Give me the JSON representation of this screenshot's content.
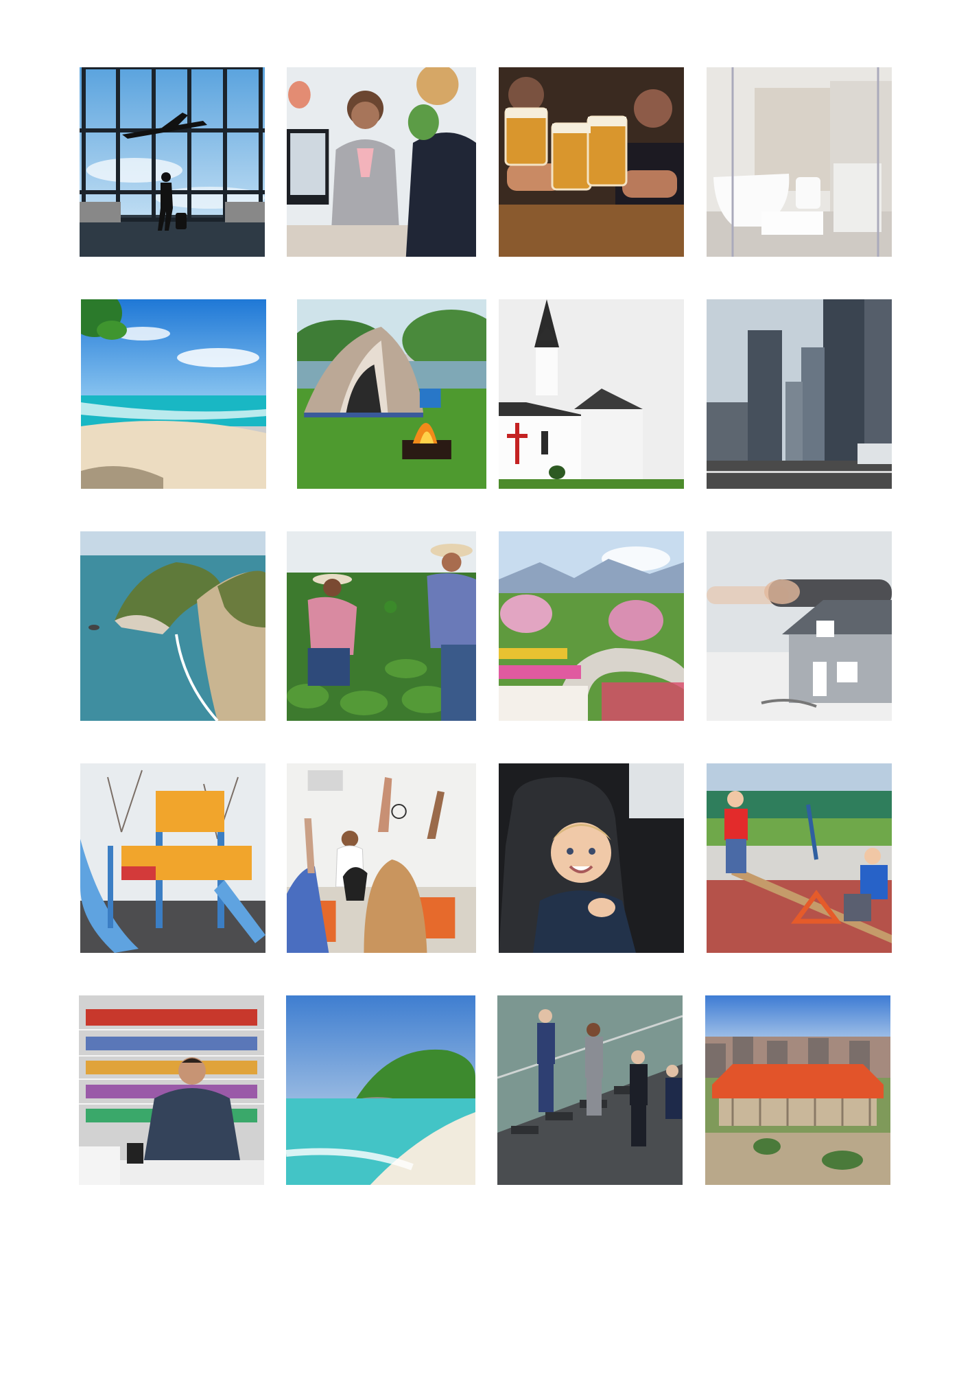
{
  "grid": {
    "rows": 5,
    "columns": 4,
    "tiles": [
      {
        "subject": "airport-traveler"
      },
      {
        "subject": "hotel-front-desk"
      },
      {
        "subject": "beer-toast"
      },
      {
        "subject": "bathroom"
      },
      {
        "subject": "tropical-beach"
      },
      {
        "subject": "tent-campfire"
      },
      {
        "subject": "white-church"
      },
      {
        "subject": "city-skyline"
      },
      {
        "subject": "coastal-cliff-cove"
      },
      {
        "subject": "farmers-in-field"
      },
      {
        "subject": "flower-garden-mountains"
      },
      {
        "subject": "house-model-handshake"
      },
      {
        "subject": "playground"
      },
      {
        "subject": "classroom-raised-hands"
      },
      {
        "subject": "baby-car-seat"
      },
      {
        "subject": "kids-on-seesaw"
      },
      {
        "subject": "shopkeeper-convenience-store"
      },
      {
        "subject": "island-beach"
      },
      {
        "subject": "business-people-stairs"
      },
      {
        "subject": "train-station-aerial"
      }
    ]
  }
}
